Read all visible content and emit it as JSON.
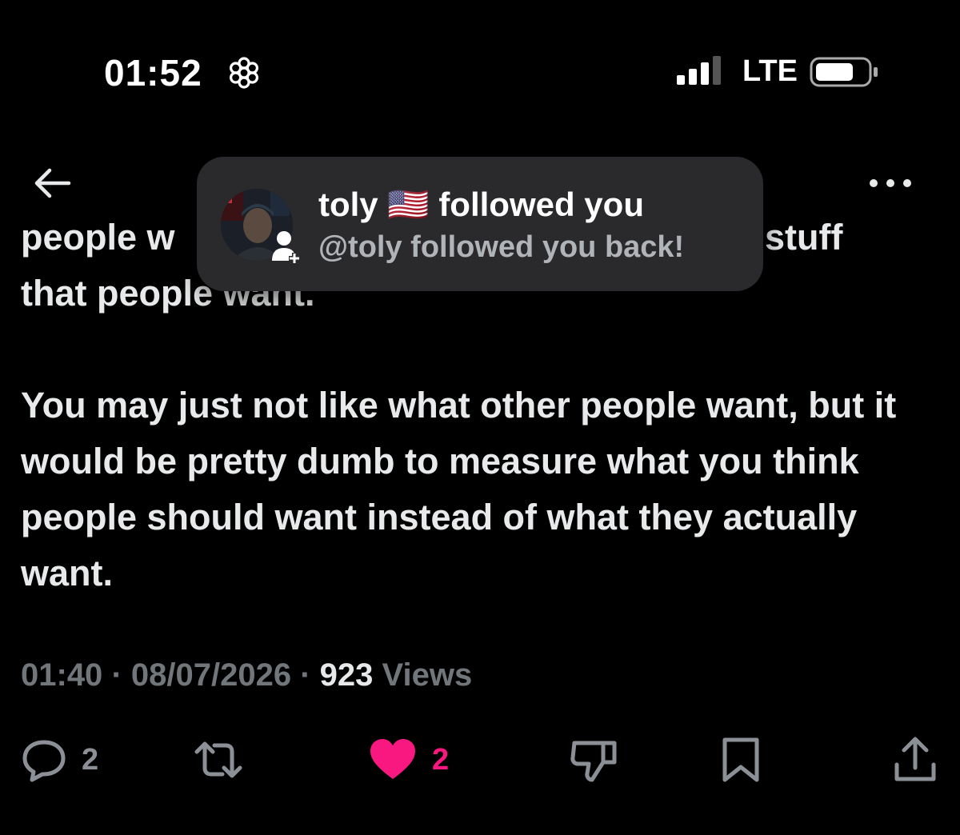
{
  "status_bar": {
    "time": "01:52",
    "focus_icon": "focus-flower-icon",
    "signal_icon": "cellular-signal-icon",
    "network": "LTE",
    "battery_icon": "battery-icon"
  },
  "nav": {
    "back_icon": "arrow-left-icon",
    "more_icon": "more-horizontal-icon"
  },
  "notification": {
    "title_name": "toly",
    "title_flag": "🇺🇸",
    "title_action": "followed you",
    "subtitle": "@toly followed you back!",
    "badge_icon": "person-add-icon"
  },
  "tweet": {
    "partial_line_1_left": "people w",
    "partial_line_1_right": "stuff",
    "partial_line_2": "that people want.",
    "paragraph_2": "You may just not like what other people want, but it would be pretty dumb to measure what you think people should want instead of what they actually want."
  },
  "meta": {
    "time": "01:40",
    "separator": "·",
    "date": "08/07/2026",
    "views_count": "923",
    "views_label": "Views"
  },
  "actions": {
    "reply_count": "2",
    "retweet_count": "",
    "like_count": "2",
    "colors": {
      "liked": "#f91880",
      "muted": "#8b9096"
    }
  }
}
